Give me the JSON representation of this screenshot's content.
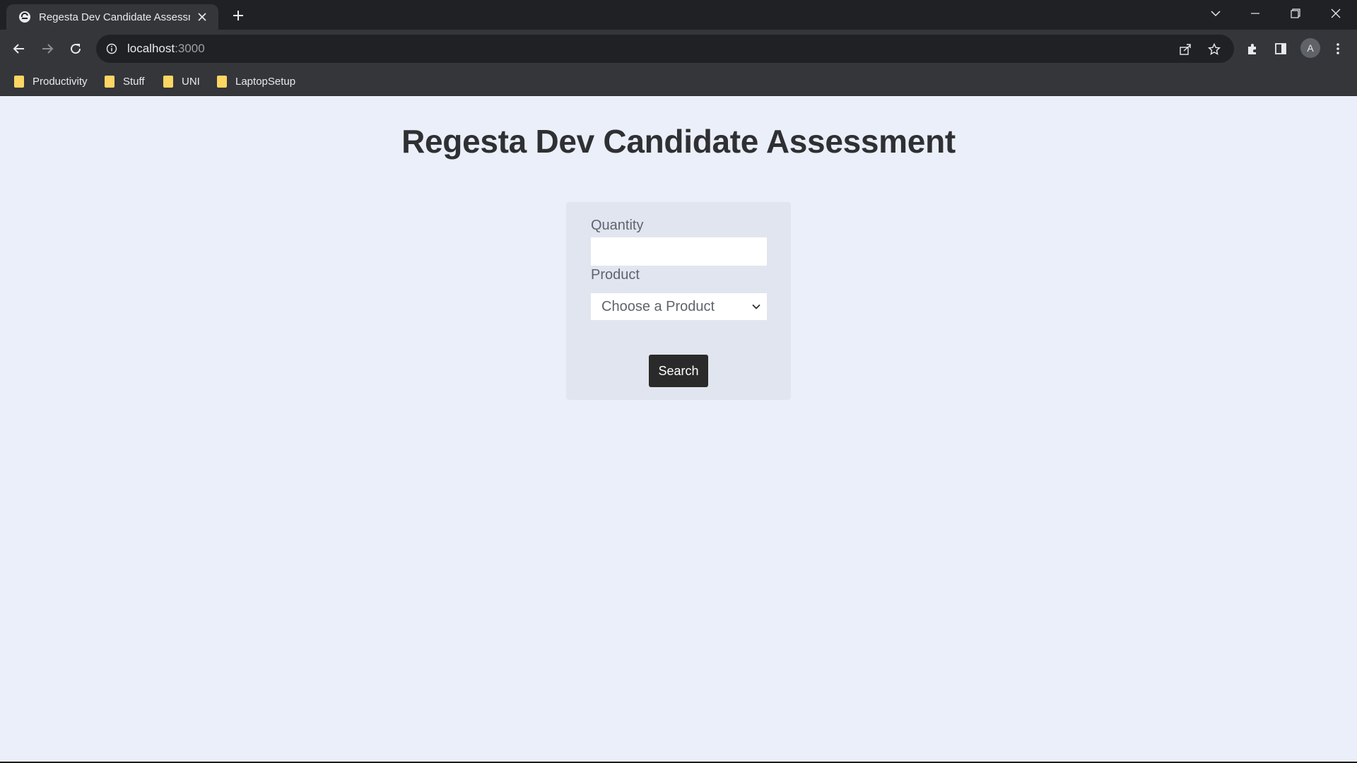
{
  "browser": {
    "tab": {
      "title": "Regesta Dev Candidate Assessment",
      "favicon": "page-icon"
    },
    "address": {
      "host": "localhost",
      "port": ":3000"
    },
    "bookmarks": [
      {
        "label": "Productivity"
      },
      {
        "label": "Stuff"
      },
      {
        "label": "UNI"
      },
      {
        "label": "LaptopSetup"
      }
    ],
    "profile_initial": "A",
    "colors": {
      "tabbar": "#202124",
      "toolbar": "#35363a",
      "folder": "#fdd663"
    }
  },
  "page": {
    "title": "Regesta Dev Candidate Assessment",
    "form": {
      "quantity_label": "Quantity",
      "quantity_value": "",
      "product_label": "Product",
      "product_selected": "Choose a Product",
      "search_label": "Search"
    },
    "colors": {
      "background": "#ebeff9",
      "card": "#e1e5ef",
      "button": "#2a2a2a"
    }
  }
}
